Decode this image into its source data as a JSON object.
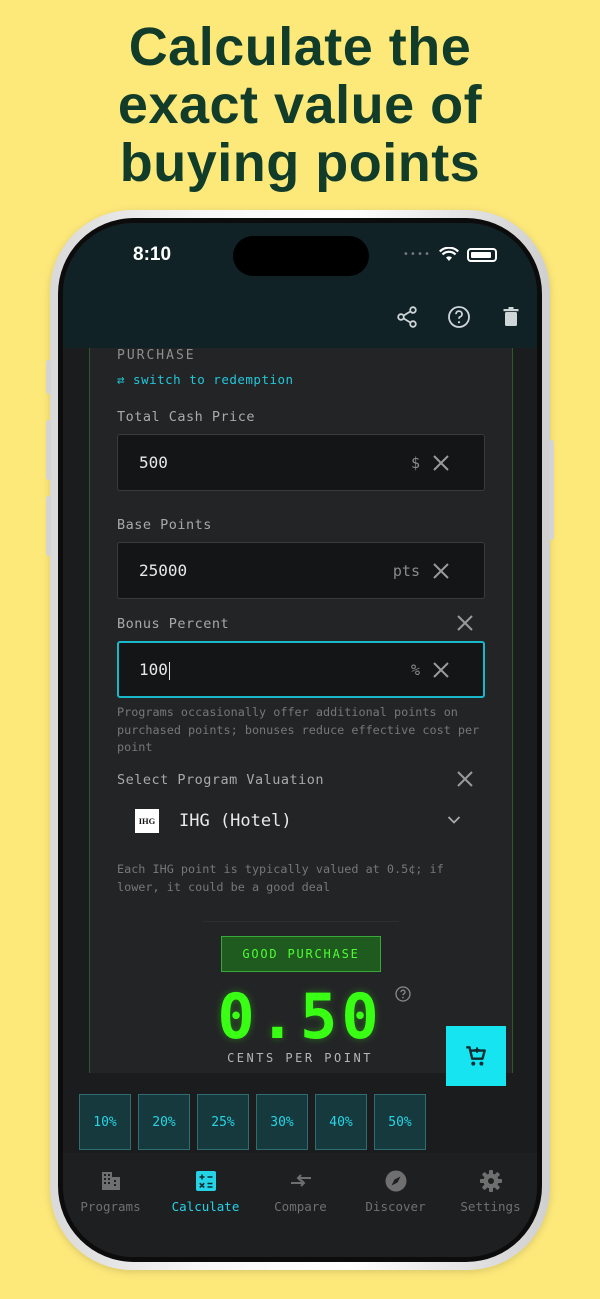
{
  "headline": {
    "line1": "Calculate the",
    "line2": "exact value of",
    "line3": "buying points"
  },
  "status_bar": {
    "time": "8:10",
    "signal_icon": "signal-dots-icon",
    "wifi_icon": "wifi-icon",
    "battery_icon": "battery-icon"
  },
  "toolbar": {
    "share_icon": "share-icon",
    "help_icon": "help-circle-icon",
    "delete_icon": "trash-icon"
  },
  "form": {
    "section_title": "PURCHASE",
    "switch_link": "⇄ switch to redemption",
    "total_cash": {
      "label": "Total Cash Price",
      "value": "500",
      "unit": "$"
    },
    "base_points": {
      "label": "Base Points",
      "value": "25000",
      "unit": "pts"
    },
    "bonus_percent": {
      "label": "Bonus Percent",
      "value": "100",
      "unit": "%",
      "helper": "Programs occasionally offer additional points on purchased points; bonuses reduce effective cost per point"
    },
    "program": {
      "label": "Select Program Valuation",
      "logo_text": "IHG",
      "name": "IHG (Hotel)",
      "helper": "Each IHG point is typically valued at 0.5¢; if lower, it could be a good deal"
    }
  },
  "result": {
    "badge": "GOOD PURCHASE",
    "value": "0.50",
    "unit_label": "CENTS PER POINT"
  },
  "quick_percents": [
    "10%",
    "20%",
    "25%",
    "30%",
    "40%",
    "50%"
  ],
  "tabs": [
    {
      "label": "Programs",
      "icon": "building-icon",
      "active": false
    },
    {
      "label": "Calculate",
      "icon": "calculator-icon",
      "active": true
    },
    {
      "label": "Compare",
      "icon": "compare-arrows-icon",
      "active": false
    },
    {
      "label": "Discover",
      "icon": "compass-icon",
      "active": false
    },
    {
      "label": "Settings",
      "icon": "gear-icon",
      "active": false
    }
  ],
  "colors": {
    "background": "#fde97a",
    "headline": "#123c2a",
    "accent_cyan": "#16e4f0",
    "good_green": "#39ff14"
  }
}
